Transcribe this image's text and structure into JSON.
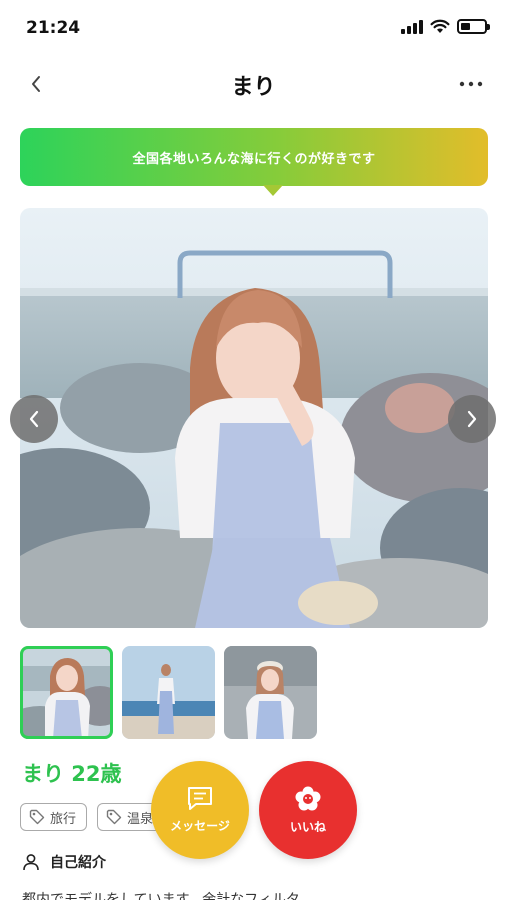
{
  "status_bar": {
    "time": "21:24"
  },
  "nav": {
    "title": "まり",
    "back_icon": "chevron-left-icon",
    "more_icon": "more-horizontal-icon"
  },
  "catchphrase": "全国各地いろんな海に行くのが好きです",
  "gallery": {
    "main_photo": "woman-in-blue-pinafore-on-rocks",
    "prev_icon": "chevron-left-icon",
    "next_icon": "chevron-right-icon",
    "thumbnails": [
      {
        "name": "thumbnail-1",
        "active": true
      },
      {
        "name": "thumbnail-2",
        "active": false
      },
      {
        "name": "thumbnail-3",
        "active": false
      }
    ]
  },
  "profile": {
    "name_age": "まり 22歳",
    "tags": [
      {
        "icon": "tag-icon",
        "label": "旅行"
      },
      {
        "icon": "tag-icon",
        "label": "温泉"
      }
    ],
    "intro_title": "自己紹介",
    "intro_icon": "person-icon",
    "intro_text_partial": "都内でモデルをしています。余計なフィルタ"
  },
  "actions": {
    "message_label": "メッセージ",
    "like_label": "いいね"
  },
  "colors": {
    "accent_green": "#2ec24f",
    "message_yellow": "#f0bd28",
    "like_red": "#e8302f"
  }
}
